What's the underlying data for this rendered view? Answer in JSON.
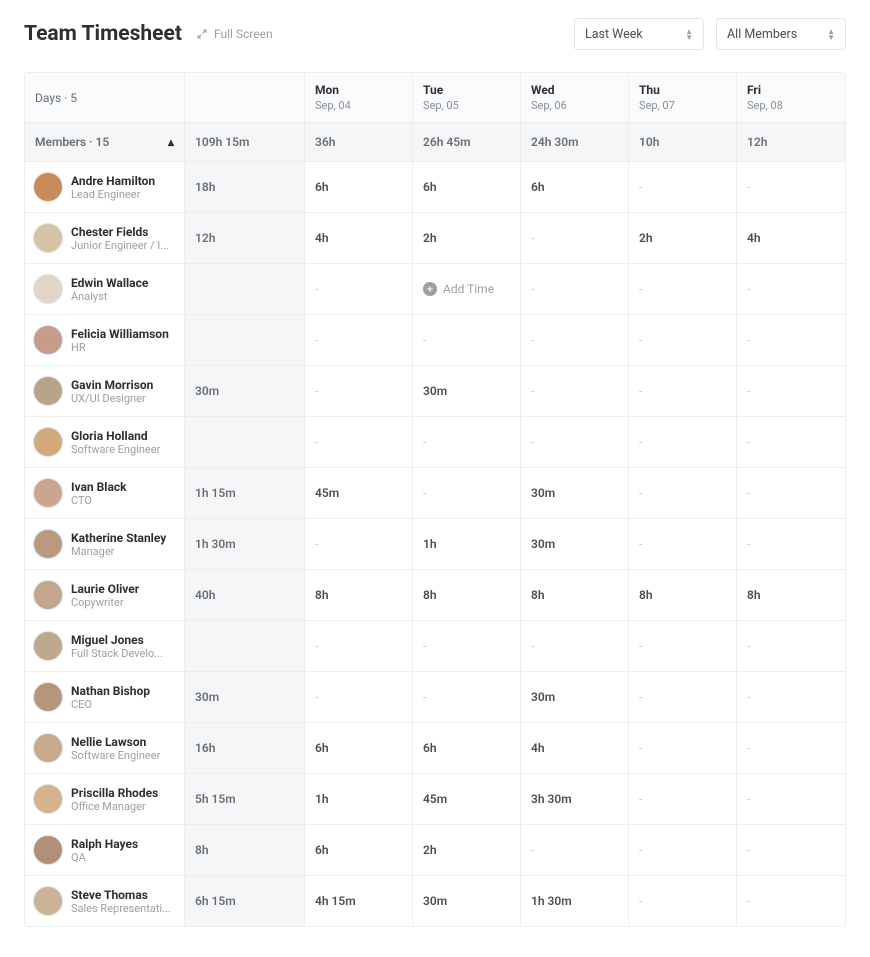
{
  "header": {
    "title": "Team Timesheet",
    "fullscreen_label": "Full Screen",
    "period_select": "Last Week",
    "members_select": "All Members"
  },
  "days_label": "Days · 5",
  "members_label": "Members · 15",
  "total_all": "109h 15m",
  "columns": [
    {
      "dow": "Mon",
      "date": "Sep, 04",
      "total": "36h"
    },
    {
      "dow": "Tue",
      "date": "Sep, 05",
      "total": "26h 45m"
    },
    {
      "dow": "Wed",
      "date": "Sep, 06",
      "total": "24h 30m"
    },
    {
      "dow": "Thu",
      "date": "Sep, 07",
      "total": "10h"
    },
    {
      "dow": "Fri",
      "date": "Sep, 08",
      "total": "12h"
    }
  ],
  "add_time_label": "Add Time",
  "avatar_colors": [
    "#c98b5a",
    "#d6c2a5",
    "#e1d6c7",
    "#c79c8a",
    "#b8a488",
    "#d1a97c",
    "#caa58f",
    "#b99a7e",
    "#c3a68e",
    "#bfa78e",
    "#b5967a",
    "#c8aa8d",
    "#d4b38e",
    "#b29078",
    "#cab397"
  ],
  "members": [
    {
      "name": "Andre Hamilton",
      "role": "Lead Engineer",
      "total": "18h",
      "cells": [
        "6h",
        "6h",
        "6h",
        "-",
        "-"
      ]
    },
    {
      "name": "Chester Fields",
      "role": "Junior Engineer / I...",
      "total": "12h",
      "cells": [
        "4h",
        "2h",
        "-",
        "2h",
        "4h"
      ]
    },
    {
      "name": "Edwin Wallace",
      "role": "Analyst",
      "total": "",
      "cells": [
        "-",
        "add",
        "-",
        "-",
        "-"
      ]
    },
    {
      "name": "Felicia Williamson",
      "role": "HR",
      "total": "",
      "cells": [
        "-",
        "-",
        "-",
        "-",
        "-"
      ]
    },
    {
      "name": "Gavin Morrison",
      "role": "UX/UI Designer",
      "total": "30m",
      "cells": [
        "-",
        "30m",
        "-",
        "-",
        "-"
      ]
    },
    {
      "name": "Gloria Holland",
      "role": "Software Engineer",
      "total": "",
      "cells": [
        "-",
        "-",
        "-",
        "-",
        "-"
      ]
    },
    {
      "name": "Ivan Black",
      "role": "CTO",
      "total": "1h 15m",
      "cells": [
        "45m",
        "-",
        "30m",
        "-",
        "-"
      ]
    },
    {
      "name": "Katherine Stanley",
      "role": "Manager",
      "total": "1h 30m",
      "cells": [
        "-",
        "1h",
        "30m",
        "-",
        "-"
      ]
    },
    {
      "name": "Laurie Oliver",
      "role": "Copywriter",
      "total": "40h",
      "cells": [
        "8h",
        "8h",
        "8h",
        "8h",
        "8h"
      ]
    },
    {
      "name": "Miguel Jones",
      "role": "Full Stack Develo...",
      "total": "",
      "cells": [
        "-",
        "-",
        "-",
        "-",
        "-"
      ]
    },
    {
      "name": "Nathan Bishop",
      "role": "CEO",
      "total": "30m",
      "cells": [
        "-",
        "-",
        "30m",
        "-",
        "-"
      ]
    },
    {
      "name": "Nellie Lawson",
      "role": "Software Engineer",
      "total": "16h",
      "cells": [
        "6h",
        "6h",
        "4h",
        "-",
        "-"
      ]
    },
    {
      "name": "Priscilla Rhodes",
      "role": "Office Manager",
      "total": "5h 15m",
      "cells": [
        "1h",
        "45m",
        "3h 30m",
        "-",
        "-"
      ]
    },
    {
      "name": "Ralph Hayes",
      "role": "QA",
      "total": "8h",
      "cells": [
        "6h",
        "2h",
        "-",
        "-",
        "-"
      ]
    },
    {
      "name": "Steve Thomas",
      "role": "Sales Representati...",
      "total": "6h 15m",
      "cells": [
        "4h 15m",
        "30m",
        "1h 30m",
        "-",
        "-"
      ]
    }
  ]
}
